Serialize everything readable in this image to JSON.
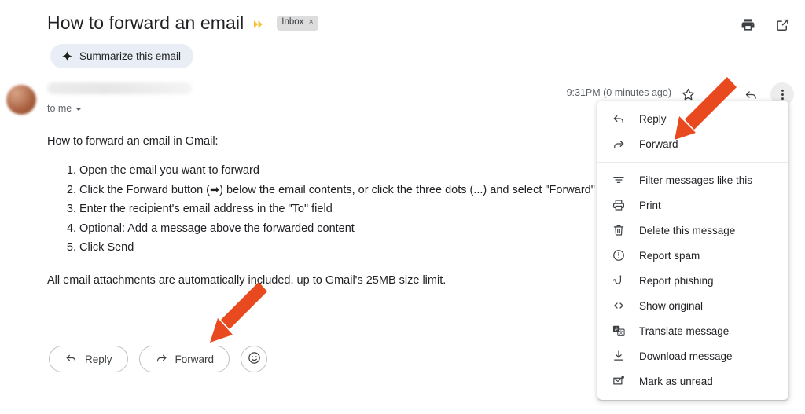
{
  "header": {
    "subject": "How to forward an email",
    "important_marker_icon": "double-chevron-important-icon",
    "label_chip": "Inbox",
    "label_chip_close": "×",
    "print_icon": "print-icon",
    "open_new_window_icon": "open-in-new-window-icon"
  },
  "summarize": {
    "label": "Summarize this email",
    "icon": "sparkle-icon"
  },
  "sender": {
    "avatar": "sender-avatar",
    "name_redacted": "",
    "recipients": "to me",
    "expand_icon": "caret-down-icon",
    "timestamp": "9:31PM (0 minutes ago)",
    "star_icon": "star-icon",
    "reply_all_icon": "reply-all-icon",
    "reply_icon": "reply-icon",
    "more_icon": "three-dots-vertical-icon"
  },
  "body": {
    "intro": "How to forward an email in Gmail:",
    "steps": [
      "Open the email you want to forward",
      "Click the Forward button (➡) below the email contents, or click the three dots (...) and select \"Forward\"",
      "Enter the recipient's email address in the \"To\" field",
      "Optional: Add a message above the forwarded content",
      "Click Send"
    ],
    "outro": "All email attachments are automatically included, up to Gmail's 25MB size limit."
  },
  "bottom_actions": {
    "reply_label": "Reply",
    "reply_icon": "reply-icon",
    "forward_label": "Forward",
    "forward_icon": "forward-arrow-icon",
    "emoji_icon": "emoji-reaction-icon"
  },
  "context_menu": {
    "groups": [
      [
        {
          "label": "Reply",
          "icon": "reply-icon"
        },
        {
          "label": "Forward",
          "icon": "forward-arrow-icon"
        }
      ],
      [
        {
          "label": "Filter messages like this",
          "icon": "filter-icon"
        },
        {
          "label": "Print",
          "icon": "print-icon"
        },
        {
          "label": "Delete this message",
          "icon": "trash-icon"
        },
        {
          "label": "Report spam",
          "icon": "exclamation-circle-icon"
        },
        {
          "label": "Report phishing",
          "icon": "fish-hook-icon"
        },
        {
          "label": "Show original",
          "icon": "code-brackets-icon"
        },
        {
          "label": "Translate message",
          "icon": "translate-icon"
        },
        {
          "label": "Download message",
          "icon": "download-icon"
        },
        {
          "label": "Mark as unread",
          "icon": "mark-unread-envelope-icon"
        }
      ]
    ]
  },
  "annotations": {
    "arrow_color": "#e8491f",
    "top_arrow_target": "Forward menu item",
    "bottom_arrow_target": "Forward button"
  }
}
